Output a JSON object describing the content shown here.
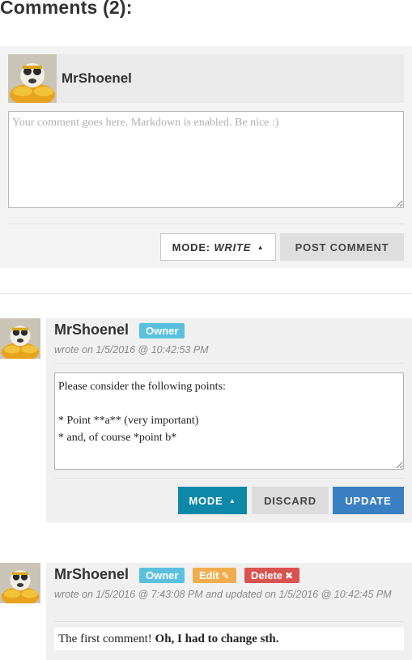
{
  "heading": "Comments (2):",
  "composer": {
    "username": "MrShoenel",
    "placeholder": "Your comment goes here. Markdown is enabled. Be nice :)",
    "mode_prefix": "MODE:",
    "mode_value": "WRITE",
    "post_label": "POST COMMENT"
  },
  "comments": [
    {
      "username": "MrShoenel",
      "badge_owner": "Owner",
      "meta": "wrote on 1/5/2016 @ 10:42:53 PM",
      "editor_text": "Please consider the following points:\n\n* Point **a** (very important)\n* and, of course *point b*",
      "mode_label": "MODE",
      "discard_label": "DISCARD",
      "update_label": "UPDATE"
    },
    {
      "username": "MrShoenel",
      "badge_owner": "Owner",
      "badge_edit": "Edit",
      "badge_delete": "Delete",
      "meta": "wrote on 1/5/2016 @ 7:43:08 PM and updated on 1/5/2016 @ 10:42:45 PM",
      "body_plain": "The first comment!",
      "body_bold": "Oh, I had to change sth."
    }
  ],
  "colors": {
    "owner_badge": "#5bc0de",
    "edit_badge": "#f0ad4e",
    "delete_badge": "#d9534f",
    "mode_button": "#0e88a8",
    "update_button": "#3a7fc1"
  }
}
